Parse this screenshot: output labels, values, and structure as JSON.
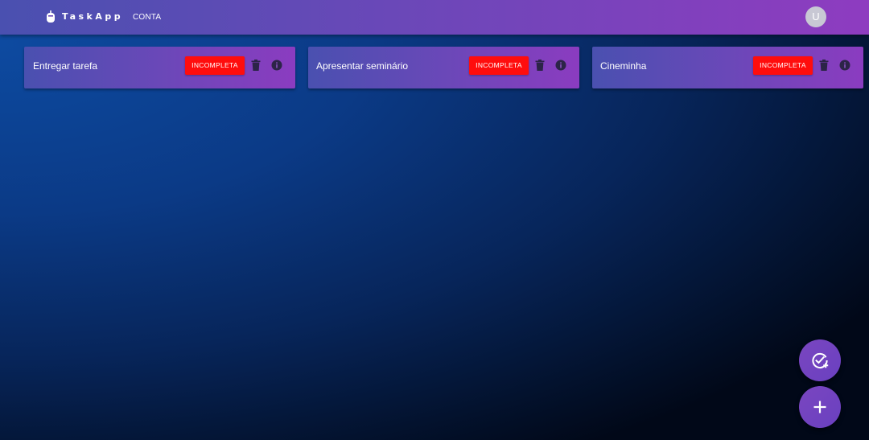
{
  "app": {
    "brand": "TaskApp",
    "nav_conta": "CONTA",
    "avatar_initial": "U"
  },
  "tasks": [
    {
      "title": "Entregar tarefa",
      "status_label": "INCOMPLETA"
    },
    {
      "title": "Apresentar seminário",
      "status_label": "INCOMPLETA"
    },
    {
      "title": "Cineminha",
      "status_label": "INCOMPLETA"
    }
  ],
  "icons": {
    "logo": "robot-icon",
    "delete": "trash-icon",
    "info": "info-icon",
    "complete_fab": "check-circle-plus-icon",
    "add_fab": "plus-icon"
  },
  "colors": {
    "status_incomplete": "#ff0d0d",
    "accent_start": "#4a50b0",
    "accent_end": "#8e3cc0"
  }
}
